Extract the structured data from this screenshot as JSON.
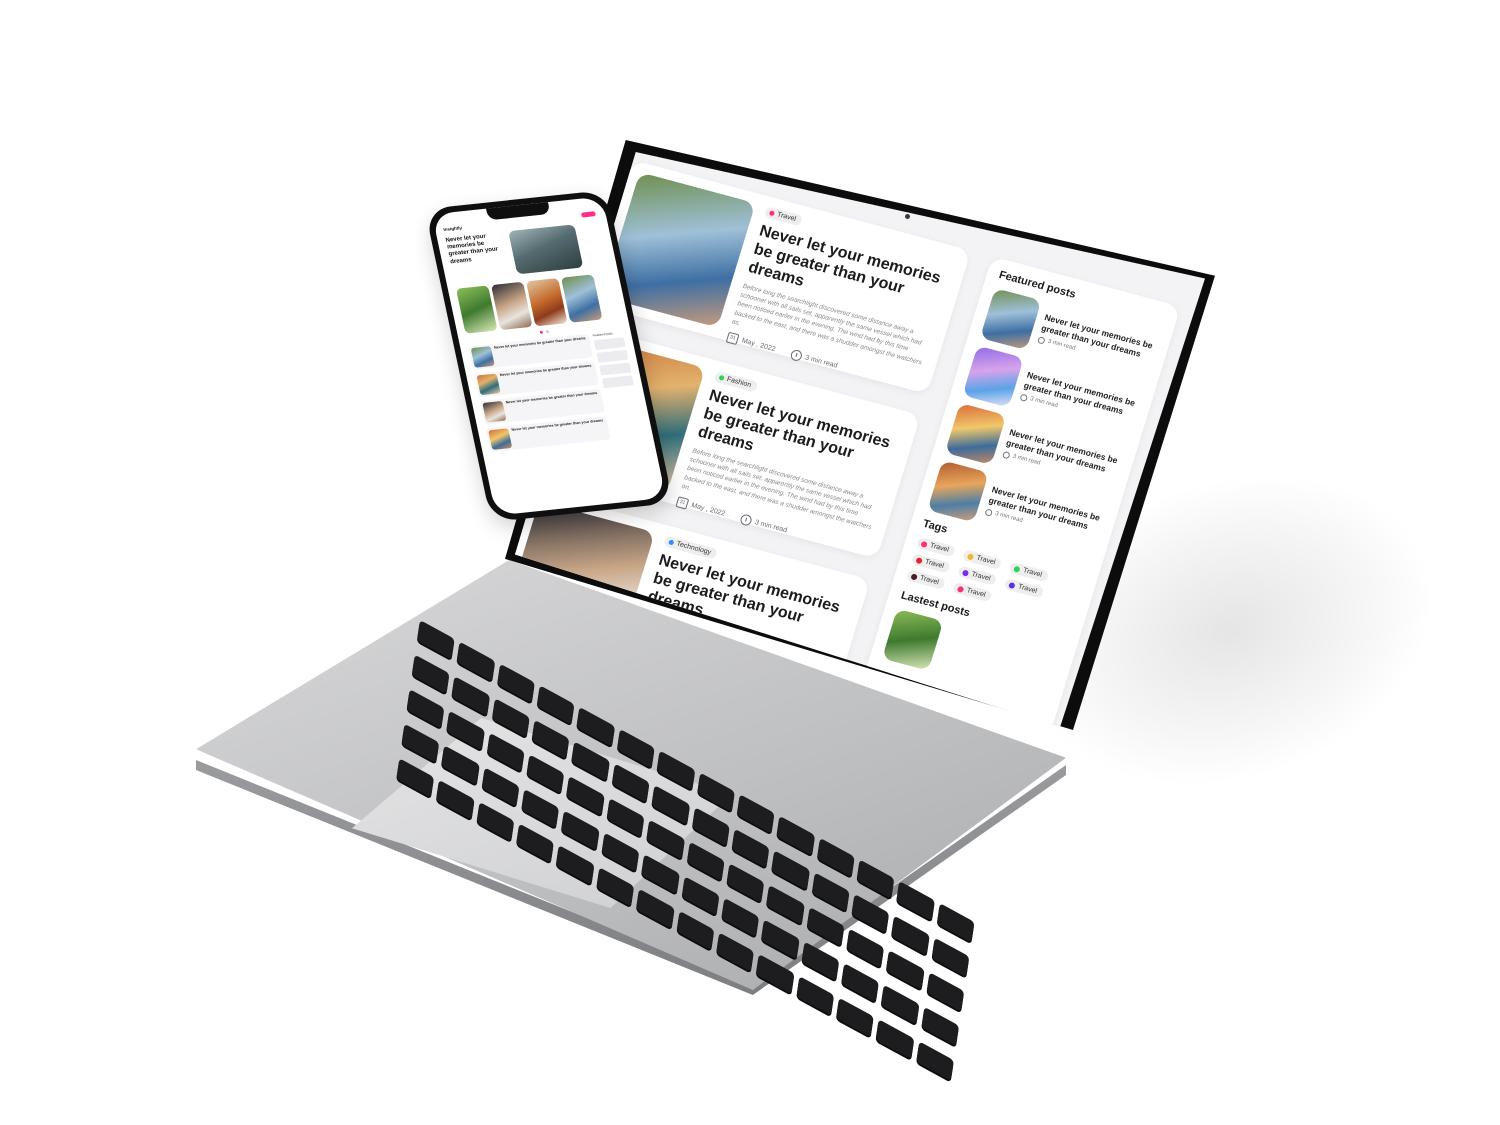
{
  "laptop": {
    "posts": [
      {
        "tag": "Travel",
        "tag_color": "#ff2e6e",
        "title": "Never let your memories be greater than your dreams",
        "excerpt": "Before long the searchlight discovered some distance away a schooner with all sails set, apparently the same vessel which had been noticed earlier in the evening. The wind had by this time backed to the east, and there was a shudder amongst the watchers as.",
        "date": "May , 2022",
        "read_time": "3 min read",
        "image": "woman-bicycle-photo"
      },
      {
        "tag": "Fashion",
        "tag_color": "#2ed35a",
        "title": "Never let your memories be greater than your dreams",
        "excerpt": "Before long the searchlight discovered some distance away a schooner with all sails set, apparently the same vessel which had been noticed earlier in the evening. The wind had by this time backed to the east, and there was a shudder amongst the watchers on.",
        "date": "May , 2022",
        "read_time": "3 min read",
        "image": "women-laughing-photo"
      },
      {
        "tag": "Technology",
        "tag_color": "#2e8bff",
        "title": "Never let your memories be greater than your dreams",
        "excerpt": "",
        "date": "",
        "read_time": "",
        "image": "family-photo"
      }
    ],
    "sidebar": {
      "featured_heading": "Featured posts",
      "featured": [
        {
          "title": "Never let your memories be greater than your dreams",
          "read_time": "3 min read"
        },
        {
          "title": "Never let your memories be greater than your dreams",
          "read_time": "3 min read"
        },
        {
          "title": "Never let your memories be greater than your dreams",
          "read_time": "3 min read"
        },
        {
          "title": "Never let your memories be greater than your dreams",
          "read_time": "3 min read"
        }
      ],
      "tags_heading": "Tags",
      "tags": [
        {
          "label": "Travel",
          "color": "#ff2e6e"
        },
        {
          "label": "Travel",
          "color": "#f2b731"
        },
        {
          "label": "Travel",
          "color": "#2ed35a"
        },
        {
          "label": "Travel",
          "color": "#e8202f"
        },
        {
          "label": "Travel",
          "color": "#7a2ee6"
        },
        {
          "label": "Travel",
          "color": "#5a2ee6"
        },
        {
          "label": "Travel",
          "color": "#4a1f24"
        },
        {
          "label": "Travel",
          "color": "#ff2e6e"
        }
      ],
      "latest_heading": "Lastest posts"
    },
    "date_icon_text": "31"
  },
  "phone": {
    "brand": "Insightly",
    "hero_title": "Never let your memories be greater than your dreams",
    "list_titles": [
      "Never let your memories be greater than your dreams",
      "Never let your memories be greater than your dreams",
      "Never let your memories be greater than your dreams",
      "Never let your memories be greater than your dreams"
    ],
    "side_heading": "Featured posts"
  }
}
